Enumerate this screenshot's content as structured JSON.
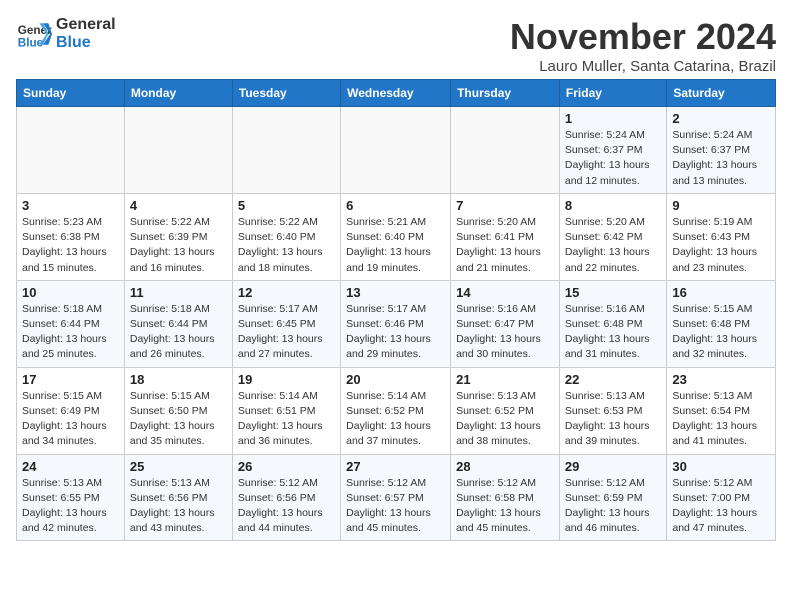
{
  "header": {
    "logo_line1": "General",
    "logo_line2": "Blue",
    "month_title": "November 2024",
    "location": "Lauro Muller, Santa Catarina, Brazil"
  },
  "columns": [
    "Sunday",
    "Monday",
    "Tuesday",
    "Wednesday",
    "Thursday",
    "Friday",
    "Saturday"
  ],
  "weeks": [
    [
      {
        "day": "",
        "info": ""
      },
      {
        "day": "",
        "info": ""
      },
      {
        "day": "",
        "info": ""
      },
      {
        "day": "",
        "info": ""
      },
      {
        "day": "",
        "info": ""
      },
      {
        "day": "1",
        "info": "Sunrise: 5:24 AM\nSunset: 6:37 PM\nDaylight: 13 hours and 12 minutes."
      },
      {
        "day": "2",
        "info": "Sunrise: 5:24 AM\nSunset: 6:37 PM\nDaylight: 13 hours and 13 minutes."
      }
    ],
    [
      {
        "day": "3",
        "info": "Sunrise: 5:23 AM\nSunset: 6:38 PM\nDaylight: 13 hours and 15 minutes."
      },
      {
        "day": "4",
        "info": "Sunrise: 5:22 AM\nSunset: 6:39 PM\nDaylight: 13 hours and 16 minutes."
      },
      {
        "day": "5",
        "info": "Sunrise: 5:22 AM\nSunset: 6:40 PM\nDaylight: 13 hours and 18 minutes."
      },
      {
        "day": "6",
        "info": "Sunrise: 5:21 AM\nSunset: 6:40 PM\nDaylight: 13 hours and 19 minutes."
      },
      {
        "day": "7",
        "info": "Sunrise: 5:20 AM\nSunset: 6:41 PM\nDaylight: 13 hours and 21 minutes."
      },
      {
        "day": "8",
        "info": "Sunrise: 5:20 AM\nSunset: 6:42 PM\nDaylight: 13 hours and 22 minutes."
      },
      {
        "day": "9",
        "info": "Sunrise: 5:19 AM\nSunset: 6:43 PM\nDaylight: 13 hours and 23 minutes."
      }
    ],
    [
      {
        "day": "10",
        "info": "Sunrise: 5:18 AM\nSunset: 6:44 PM\nDaylight: 13 hours and 25 minutes."
      },
      {
        "day": "11",
        "info": "Sunrise: 5:18 AM\nSunset: 6:44 PM\nDaylight: 13 hours and 26 minutes."
      },
      {
        "day": "12",
        "info": "Sunrise: 5:17 AM\nSunset: 6:45 PM\nDaylight: 13 hours and 27 minutes."
      },
      {
        "day": "13",
        "info": "Sunrise: 5:17 AM\nSunset: 6:46 PM\nDaylight: 13 hours and 29 minutes."
      },
      {
        "day": "14",
        "info": "Sunrise: 5:16 AM\nSunset: 6:47 PM\nDaylight: 13 hours and 30 minutes."
      },
      {
        "day": "15",
        "info": "Sunrise: 5:16 AM\nSunset: 6:48 PM\nDaylight: 13 hours and 31 minutes."
      },
      {
        "day": "16",
        "info": "Sunrise: 5:15 AM\nSunset: 6:48 PM\nDaylight: 13 hours and 32 minutes."
      }
    ],
    [
      {
        "day": "17",
        "info": "Sunrise: 5:15 AM\nSunset: 6:49 PM\nDaylight: 13 hours and 34 minutes."
      },
      {
        "day": "18",
        "info": "Sunrise: 5:15 AM\nSunset: 6:50 PM\nDaylight: 13 hours and 35 minutes."
      },
      {
        "day": "19",
        "info": "Sunrise: 5:14 AM\nSunset: 6:51 PM\nDaylight: 13 hours and 36 minutes."
      },
      {
        "day": "20",
        "info": "Sunrise: 5:14 AM\nSunset: 6:52 PM\nDaylight: 13 hours and 37 minutes."
      },
      {
        "day": "21",
        "info": "Sunrise: 5:13 AM\nSunset: 6:52 PM\nDaylight: 13 hours and 38 minutes."
      },
      {
        "day": "22",
        "info": "Sunrise: 5:13 AM\nSunset: 6:53 PM\nDaylight: 13 hours and 39 minutes."
      },
      {
        "day": "23",
        "info": "Sunrise: 5:13 AM\nSunset: 6:54 PM\nDaylight: 13 hours and 41 minutes."
      }
    ],
    [
      {
        "day": "24",
        "info": "Sunrise: 5:13 AM\nSunset: 6:55 PM\nDaylight: 13 hours and 42 minutes."
      },
      {
        "day": "25",
        "info": "Sunrise: 5:13 AM\nSunset: 6:56 PM\nDaylight: 13 hours and 43 minutes."
      },
      {
        "day": "26",
        "info": "Sunrise: 5:12 AM\nSunset: 6:56 PM\nDaylight: 13 hours and 44 minutes."
      },
      {
        "day": "27",
        "info": "Sunrise: 5:12 AM\nSunset: 6:57 PM\nDaylight: 13 hours and 45 minutes."
      },
      {
        "day": "28",
        "info": "Sunrise: 5:12 AM\nSunset: 6:58 PM\nDaylight: 13 hours and 45 minutes."
      },
      {
        "day": "29",
        "info": "Sunrise: 5:12 AM\nSunset: 6:59 PM\nDaylight: 13 hours and 46 minutes."
      },
      {
        "day": "30",
        "info": "Sunrise: 5:12 AM\nSunset: 7:00 PM\nDaylight: 13 hours and 47 minutes."
      }
    ]
  ]
}
